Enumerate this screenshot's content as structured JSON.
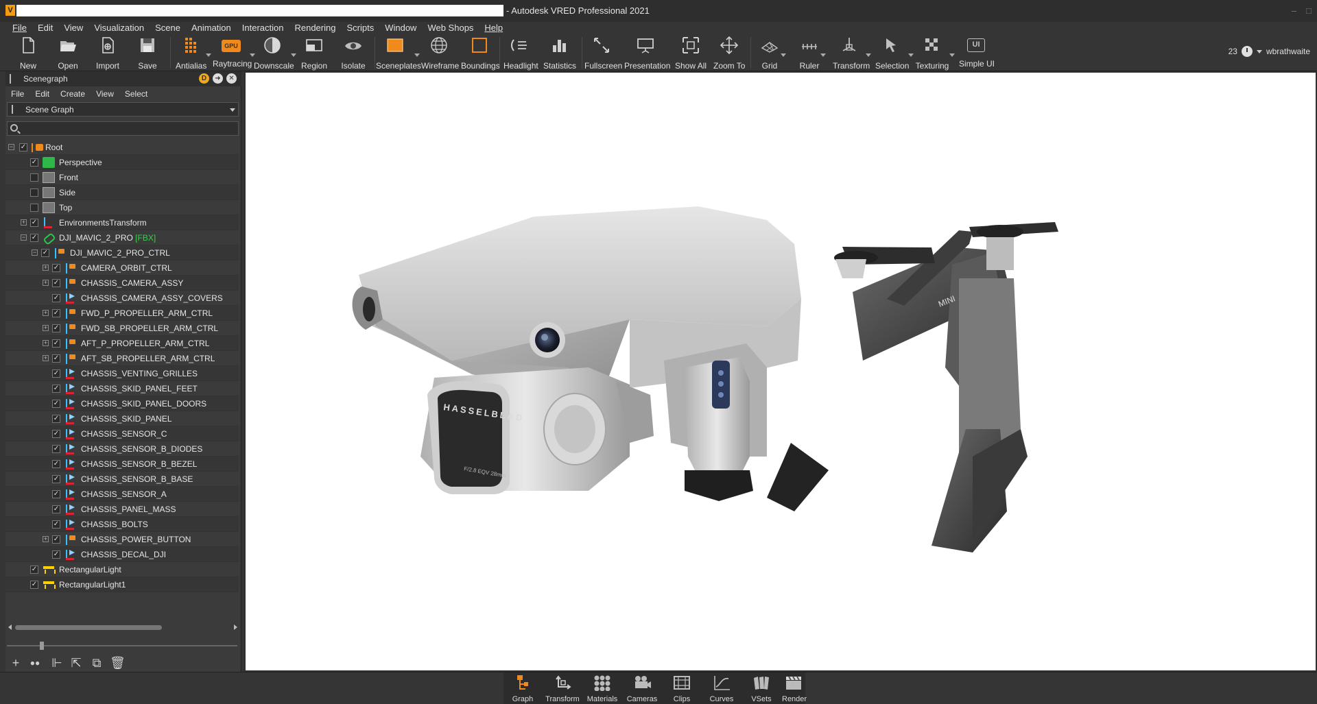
{
  "window": {
    "app_logo": "V",
    "title": "- Autodesk VRED Professional 2021",
    "controls": [
      "–",
      "□"
    ]
  },
  "menubar": [
    "File",
    "Edit",
    "View",
    "Visualization",
    "Scene",
    "Animation",
    "Interaction",
    "Rendering",
    "Scripts",
    "Window",
    "Web Shops",
    "Help"
  ],
  "toolbar": {
    "buttons": [
      {
        "label": "New",
        "icon": "new-file-icon"
      },
      {
        "label": "Open",
        "icon": "folder-open-icon"
      },
      {
        "label": "Import",
        "icon": "import-icon"
      },
      {
        "label": "Save",
        "icon": "save-icon"
      },
      {
        "label": "Antialias",
        "icon": "antialias-grid-icon"
      },
      {
        "label": "Raytracing",
        "icon": "gpu-icon",
        "badge": "GPU"
      },
      {
        "label": "Downscale",
        "icon": "downscale-icon"
      },
      {
        "label": "Region",
        "icon": "region-icon"
      },
      {
        "label": "Isolate",
        "icon": "isolate-eye-icon"
      },
      {
        "label": "Sceneplates",
        "icon": "sceneplates-icon"
      },
      {
        "label": "Wireframe",
        "icon": "wireframe-globe-icon"
      },
      {
        "label": "Boundings",
        "icon": "boundings-box-icon"
      },
      {
        "label": "Headlight",
        "icon": "headlight-icon"
      },
      {
        "label": "Statistics",
        "icon": "statistics-bars-icon"
      },
      {
        "label": "Fullscreen",
        "icon": "fullscreen-arrows-icon"
      },
      {
        "label": "Presentation",
        "icon": "presentation-icon"
      },
      {
        "label": "Show All",
        "icon": "show-all-icon"
      },
      {
        "label": "Zoom To",
        "icon": "zoom-to-icon"
      },
      {
        "label": "Grid",
        "icon": "grid-icon"
      },
      {
        "label": "Ruler",
        "icon": "ruler-icon"
      },
      {
        "label": "Transform",
        "icon": "transform-icon"
      },
      {
        "label": "Selection",
        "icon": "selection-icon"
      },
      {
        "label": "Texturing",
        "icon": "texturing-checker-icon"
      },
      {
        "label": "Simple UI",
        "icon": "simple-ui-icon",
        "badge": "UI"
      }
    ],
    "render_count": "23",
    "user": "wbrathwaite"
  },
  "scenegraph": {
    "title": "Scenegraph",
    "header_badge": "D",
    "menu": [
      "File",
      "Edit",
      "Create",
      "View",
      "Select"
    ],
    "view_mode": "Scene Graph",
    "search_placeholder": "",
    "nodes": [
      {
        "label": "Root",
        "checked": true
      },
      {
        "label": "Perspective",
        "checked": true
      },
      {
        "label": "Front",
        "checked": false
      },
      {
        "label": "Side",
        "checked": false
      },
      {
        "label": "Top",
        "checked": false
      },
      {
        "label": "EnvironmentsTransform",
        "checked": true
      },
      {
        "label": "DJI_MAVIC_2_PRO",
        "tag": "[FBX]",
        "checked": true
      },
      {
        "label": "DJI_MAVIC_2_PRO_CTRL",
        "checked": true
      },
      {
        "label": "CAMERA_ORBIT_CTRL",
        "checked": true
      },
      {
        "label": "CHASSIS_CAMERA_ASSY",
        "checked": true
      },
      {
        "label": "CHASSIS_CAMERA_ASSY_COVERS",
        "checked": true
      },
      {
        "label": "FWD_P_PROPELLER_ARM_CTRL",
        "checked": true
      },
      {
        "label": "FWD_SB_PROPELLER_ARM_CTRL",
        "checked": true
      },
      {
        "label": "AFT_P_PROPELLER_ARM_CTRL",
        "checked": true
      },
      {
        "label": "AFT_SB_PROPELLER_ARM_CTRL",
        "checked": true
      },
      {
        "label": "CHASSIS_VENTING_GRILLES",
        "checked": true
      },
      {
        "label": "CHASSIS_SKID_PANEL_FEET",
        "checked": true
      },
      {
        "label": "CHASSIS_SKID_PANEL_DOORS",
        "checked": true
      },
      {
        "label": "CHASSIS_SKID_PANEL",
        "checked": true
      },
      {
        "label": "CHASSIS_SENSOR_C",
        "checked": true
      },
      {
        "label": "CHASSIS_SENSOR_B_DIODES",
        "checked": true
      },
      {
        "label": "CHASSIS_SENSOR_B_BEZEL",
        "checked": true
      },
      {
        "label": "CHASSIS_SENSOR_B_BASE",
        "checked": true
      },
      {
        "label": "CHASSIS_SENSOR_A",
        "checked": true
      },
      {
        "label": "CHASSIS_PANEL_MASS",
        "checked": true
      },
      {
        "label": "CHASSIS_BOLTS",
        "checked": true
      },
      {
        "label": "CHASSIS_POWER_BUTTON",
        "checked": true
      },
      {
        "label": "CHASSIS_DECAL_DJI",
        "checked": true
      },
      {
        "label": "RectangularLight",
        "checked": true
      },
      {
        "label": "RectangularLight1",
        "checked": true
      }
    ],
    "footer_buttons": [
      "add-node-icon",
      "visibility-icon",
      "group-icon",
      "move-up-icon",
      "clone-icon",
      "delete-icon"
    ]
  },
  "viewport": {
    "model": {
      "lens_brand": "HASSELBLAD",
      "lens_spec": "F/2.8 EQV 28mm",
      "arm_marking": "MINI"
    }
  },
  "dock": [
    "Graph",
    "Transform",
    "Materials",
    "Cameras",
    "Clips",
    "Curves",
    "VSets",
    "Render"
  ]
}
